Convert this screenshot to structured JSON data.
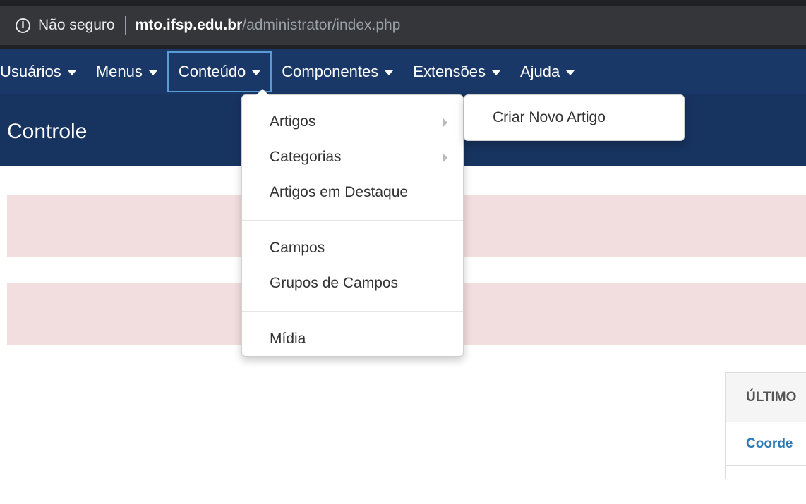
{
  "browser": {
    "security_label": "Não seguro",
    "url_host": "mto.ifsp.edu.br",
    "url_path": "/administrator/index.php"
  },
  "navbar": {
    "items": [
      {
        "label": "Usuários"
      },
      {
        "label": "Menus"
      },
      {
        "label": "Conteúdo"
      },
      {
        "label": "Componentes"
      },
      {
        "label": "Extensões"
      },
      {
        "label": "Ajuda"
      }
    ]
  },
  "header": {
    "title": "Controle"
  },
  "dropdown": {
    "items": [
      {
        "label": "Artigos"
      },
      {
        "label": "Categorias"
      },
      {
        "label": "Artigos em Destaque"
      },
      {
        "label": "Campos"
      },
      {
        "label": "Grupos de Campos"
      },
      {
        "label": "Mídia"
      }
    ]
  },
  "submenu": {
    "label": "Criar Novo Artigo"
  },
  "panel": {
    "heading": "ÚLTIMO",
    "row": "Coorde"
  },
  "colors": {
    "navbar": "#1a3867",
    "header": "#17335f",
    "alert": "#f2dede",
    "link": "#2a7ab8"
  }
}
